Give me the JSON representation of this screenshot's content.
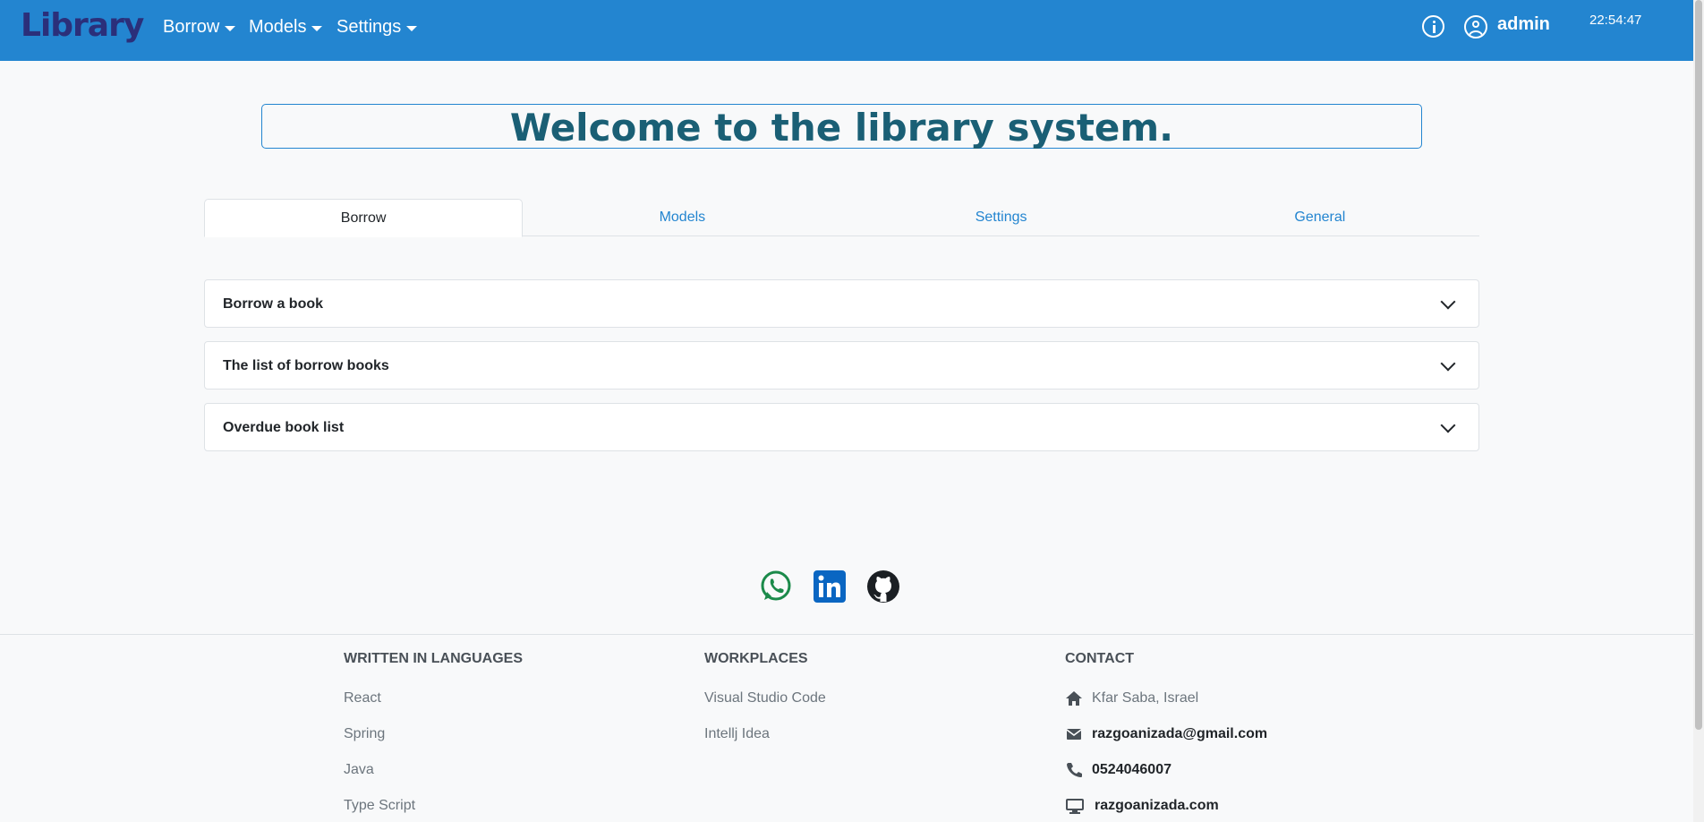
{
  "navbar": {
    "brand": "Library",
    "menus": [
      {
        "label": "Borrow"
      },
      {
        "label": "Models"
      },
      {
        "label": "Settings"
      }
    ],
    "username": "admin",
    "clock": "22:54:47"
  },
  "welcome": {
    "title": "Welcome to the library system."
  },
  "tabs": [
    {
      "label": "Borrow",
      "active": true
    },
    {
      "label": "Models",
      "active": false
    },
    {
      "label": "Settings",
      "active": false
    },
    {
      "label": "General",
      "active": false
    }
  ],
  "accordion": [
    {
      "label": "Borrow a book"
    },
    {
      "label": "The list of borrow books"
    },
    {
      "label": "Overdue book list"
    }
  ],
  "social": [
    {
      "icon": "whatsapp-icon",
      "color": "#1b8a4a"
    },
    {
      "icon": "linkedin-icon",
      "color": "#0a66c2"
    },
    {
      "icon": "github-icon",
      "color": "#1b1f23"
    }
  ],
  "footer": {
    "languages": {
      "title": "Written in languages",
      "items": [
        "React",
        "Spring",
        "Java",
        "Type Script"
      ]
    },
    "workplaces": {
      "title": "Workplaces",
      "items": [
        "Visual Studio Code",
        "Intellj Idea"
      ]
    },
    "contact": {
      "title": "Contact",
      "address": "Kfar Saba, Israel",
      "email": "razgoanizada@gmail.com",
      "phone": "0524046007",
      "website": "razgoanizada.com"
    }
  },
  "colors": {
    "navbar": "#2385d0",
    "brand": "#2b2f7a",
    "welcome_text": "#1a5f75",
    "link": "#2385d0"
  }
}
